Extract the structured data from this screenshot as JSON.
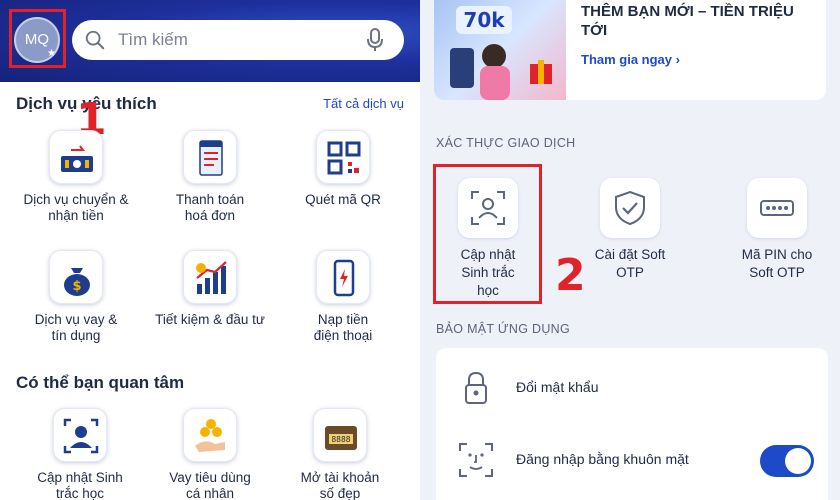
{
  "header": {
    "avatar_initials": "MQ",
    "search_placeholder": "Tìm kiếm"
  },
  "favorites": {
    "title": "Dịch vụ yêu thích",
    "see_all": "Tất cả dịch vụ",
    "items": [
      {
        "label_1": "Dịch vụ chuyển &",
        "label_2": "nhận tiền",
        "icon": "money-transfer-icon"
      },
      {
        "label_1": "Thanh toán",
        "label_2": "hoá đơn",
        "icon": "bill-icon"
      },
      {
        "label_1": "Quét mã QR",
        "label_2": "",
        "icon": "qr-code-icon"
      },
      {
        "label_1": "Dịch vụ vay &",
        "label_2": "tín dụng",
        "icon": "loan-bag-icon"
      },
      {
        "label_1": "Tiết kiệm & đầu tư",
        "label_2": "",
        "icon": "savings-chart-icon"
      },
      {
        "label_1": "Nạp tiền",
        "label_2": "điện thoại",
        "icon": "phone-topup-icon"
      }
    ]
  },
  "interest": {
    "title": "Có thể bạn quan tâm",
    "items": [
      {
        "label_1": "Cập nhật Sinh",
        "label_2": "trắc học",
        "icon": "biometric-user-icon"
      },
      {
        "label_1": "Vay tiêu dùng",
        "label_2": "cá nhân",
        "icon": "coins-hand-icon"
      },
      {
        "label_1": "Mở tài khoản",
        "label_2": "số đẹp",
        "icon": "wallet-number-icon"
      }
    ]
  },
  "annotations": {
    "num_1": "1",
    "num_2": "2"
  },
  "promo": {
    "title": "THÊM BẠN MỚI – TIỀN TRIỆU TỚI",
    "link": "Tham gia ngay",
    "badge": "70k"
  },
  "auth": {
    "caption": "XÁC THỰC GIAO DỊCH",
    "items": [
      {
        "label_1": "Cập nhật",
        "label_2": "Sinh trắc",
        "label_3": "học",
        "icon": "face-scan-icon"
      },
      {
        "label_1": "Cài đặt Soft",
        "label_2": "OTP",
        "label_3": "",
        "icon": "shield-check-icon"
      },
      {
        "label_1": "Mã PIN cho",
        "label_2": "Soft OTP",
        "label_3": "",
        "icon": "pin-code-icon"
      }
    ]
  },
  "security": {
    "caption": "BẢO MẬT ỨNG DỤNG",
    "items": [
      {
        "label": "Đổi mật khẩu",
        "icon": "lock-icon"
      },
      {
        "label": "Đăng nhập bằng khuôn mặt",
        "icon": "face-id-icon",
        "toggle_on": true
      }
    ]
  },
  "colors": {
    "brand": "#1d4ac8",
    "annotation": "#e0232a"
  }
}
